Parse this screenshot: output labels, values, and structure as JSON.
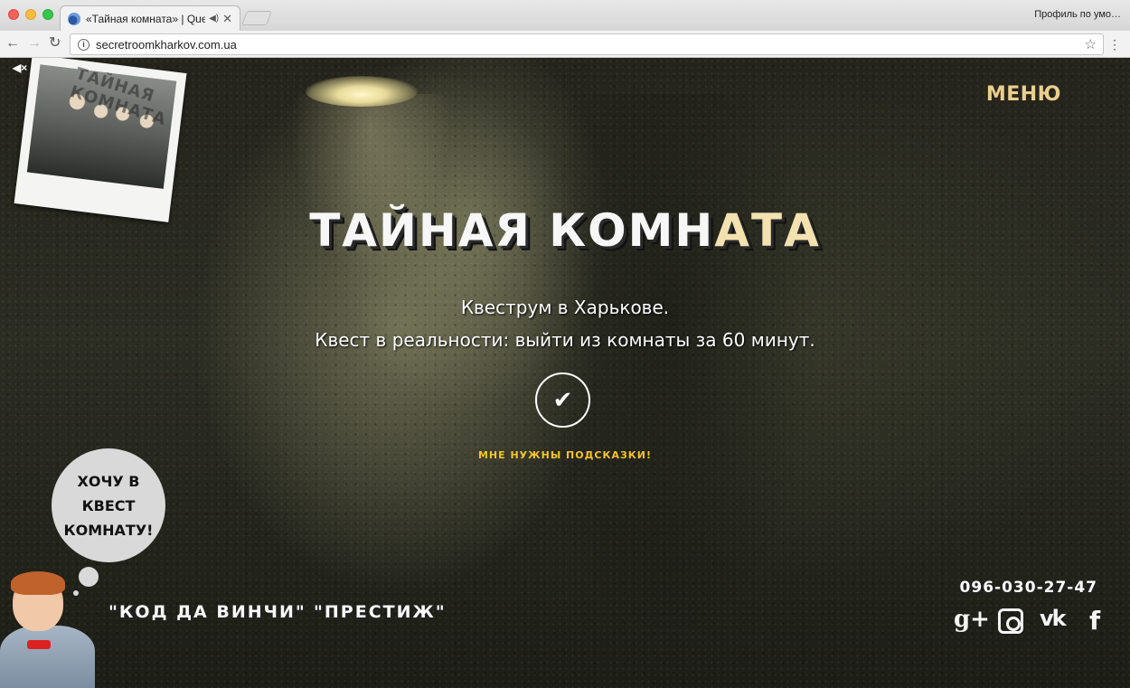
{
  "browser": {
    "tab_title": "«Тайная комната» | Quest",
    "tab_audio_icon": "speaker-icon",
    "tab_close": "✕",
    "profile_label": "Профиль по умо…",
    "url": "secretroomkharkov.com.ua"
  },
  "page": {
    "mute_label": "◀×",
    "polaroid_caption": "ТАЙНАЯ КОМНАТА",
    "menu_label": "МЕНЮ",
    "title_main": "ТАЙНАЯ КОМН",
    "title_accent": "АТА",
    "tagline_line1": "Квеструм в Харькове.",
    "tagline_line2": "Квест в реальности: выйти из комнаты за 60 минут.",
    "check_glyph": "✔",
    "hints_label": "МНЕ НУЖНЫ ПОДСКАЗКИ!",
    "bubble_line1": "ХОЧУ В",
    "bubble_line2": "КВЕСТ",
    "bubble_line3": "КОМНАТУ!",
    "quests": [
      "\"КОД ДА ВИНЧИ\"",
      "\"ПРЕСТИЖ\""
    ],
    "phone": "096-030-27-47",
    "social": {
      "gplus": "g+",
      "vk": "vk",
      "fb": "f"
    },
    "colors": {
      "menu": "#e9cf8f",
      "hints": "#f5c52a",
      "title_accent": "#f3e2b0"
    }
  }
}
